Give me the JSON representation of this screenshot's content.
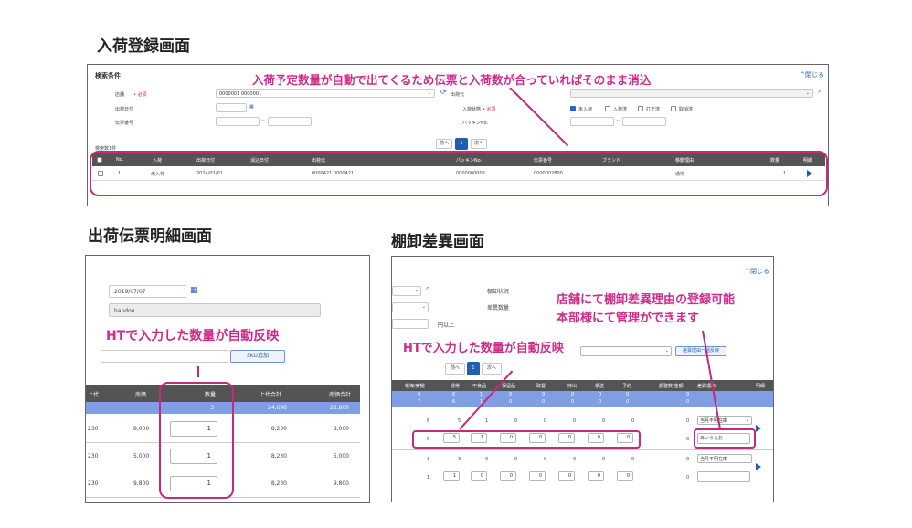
{
  "colors": {
    "accent": "#d12a8a",
    "box": "#c62a7b",
    "header_bar": "#545454",
    "blue_row": "#7f9ee6",
    "link": "#1f5fb0"
  },
  "arrival": {
    "section_title": "入荷登録画面",
    "panel_title": "検索条件",
    "close_label": "^閉じる",
    "callout": "入荷予定数量が自動で出てくるため伝票と入荷数が合っていればそのまま消込",
    "store_label": "店舗",
    "required": "• 必須",
    "store_value": "0000001 0000001",
    "supplier_label": "出荷元",
    "ship_date_label": "出荷日付",
    "arrival_status_label": "入荷状態",
    "slip_no_label": "伝票番号",
    "packing_no_label": "パッキンNo.",
    "tilde": "~",
    "status_options": [
      "未入荷",
      "入荷済",
      "訂正済",
      "取消済"
    ],
    "result_count": "検索数1件",
    "pager": {
      "prev": "前へ",
      "current": "1",
      "next": "次へ"
    },
    "headers": [
      "No.",
      "入荷",
      "出荷日付",
      "消込日付",
      "出荷元",
      "パッキンNo.",
      "伝票番号",
      "ブランド",
      "移動理由",
      "数量",
      "明細"
    ],
    "row": {
      "no": "1",
      "status": "未入荷",
      "ship_date": "2024/01/01",
      "supplier": "0000421 0000421",
      "packing_no": "0000000003",
      "slip_no": "0000002800",
      "reason": "通常",
      "qty": "1"
    }
  },
  "shipping": {
    "section_title": "出荷伝票明細画面",
    "date_value": "2019/07/07",
    "name_value": "handou",
    "callout": "HTで入力した数量が自動反映",
    "sku_button": "SKU追加",
    "headers": {
      "cost": "上代",
      "price": "売価",
      "qty": "数量",
      "cost_total": "上代合計",
      "price_total": "売価合計"
    },
    "summary": {
      "qty": "3",
      "cost_total": "24,690",
      "price_total": "22,800"
    },
    "rows": [
      {
        "cost": "230",
        "price": "8,000",
        "qty": "1",
        "cost_total": "8,230",
        "price_total": "8,000"
      },
      {
        "cost": "230",
        "price": "5,000",
        "qty": "1",
        "cost_total": "8,230",
        "price_total": "5,000"
      },
      {
        "cost": "230",
        "price": "9,800",
        "qty": "1",
        "cost_total": "8,230",
        "price_total": "9,800"
      }
    ]
  },
  "inventory": {
    "section_title": "棚卸差異画面",
    "close_label": "^閉じる",
    "status_label": "棚卸状況",
    "diff_qty_label": "差異数量",
    "above_label": "円以上",
    "callout_1": "HTで入力した数量が自動反映",
    "callout_2_line1": "店舗にて棚卸差異理由の登録可能",
    "callout_2_line2": "本部様にて管理ができます",
    "bulk_button": "差異理由一括反映",
    "pager": {
      "prev": "前へ",
      "current": "1",
      "next": "次へ"
    },
    "headers": [
      "帳簿/実棚",
      "通常",
      "不良品",
      "保留品",
      "取置",
      "持出",
      "積送",
      "予約",
      "調整数/金額",
      "差異理由",
      "明細"
    ],
    "summary_rows": [
      [
        "9",
        "8",
        "1",
        "0",
        "0",
        "0",
        "0",
        "0",
        "0"
      ],
      [
        "7",
        "6",
        "1",
        "0",
        "0",
        "0",
        "0",
        "0",
        "0"
      ]
    ],
    "blocks": [
      {
        "book": [
          "6",
          "5",
          "1",
          "0",
          "0",
          "0",
          "0",
          "0"
        ],
        "actual_lead": "6",
        "actual": [
          "5",
          "1",
          "0",
          "0",
          "0",
          "0",
          "0"
        ],
        "adjust_top": "0",
        "adjust_bottom": "0",
        "reason": "当月不明在庫",
        "reason_text": "あいうえお"
      },
      {
        "book": [
          "3",
          "3",
          "0",
          "0",
          "0",
          "0",
          "0",
          "0"
        ],
        "actual_lead": "1",
        "actual": [
          "1",
          "0",
          "0",
          "0",
          "0",
          "0",
          "0"
        ],
        "adjust_top": "0",
        "adjust_bottom": "0",
        "reason": "当月不明在庫",
        "reason_text": ""
      }
    ]
  }
}
